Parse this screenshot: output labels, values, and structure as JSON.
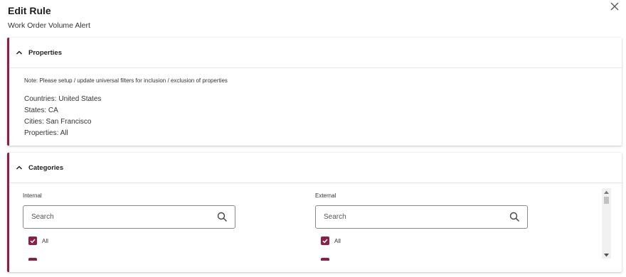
{
  "dialog": {
    "title": "Edit Rule",
    "subtitle": "Work Order Volume Alert",
    "close_icon": "close-icon"
  },
  "properties": {
    "header": "Properties",
    "note": "Note: Please setup / update universal filters for inclusion / exclusion of properties",
    "items": [
      "Countries: United States",
      "States: CA",
      "Cities: San Francisco",
      "Properties: All"
    ]
  },
  "categories": {
    "header": "Categories",
    "internal": {
      "label": "Internal",
      "search_placeholder": "Search",
      "all_label": "All",
      "all_checked": true
    },
    "external": {
      "label": "External",
      "search_placeholder": "Search",
      "all_label": "All",
      "all_checked": true
    }
  },
  "colors": {
    "accent": "#8c1e4a",
    "border": "#e4e4e4"
  }
}
